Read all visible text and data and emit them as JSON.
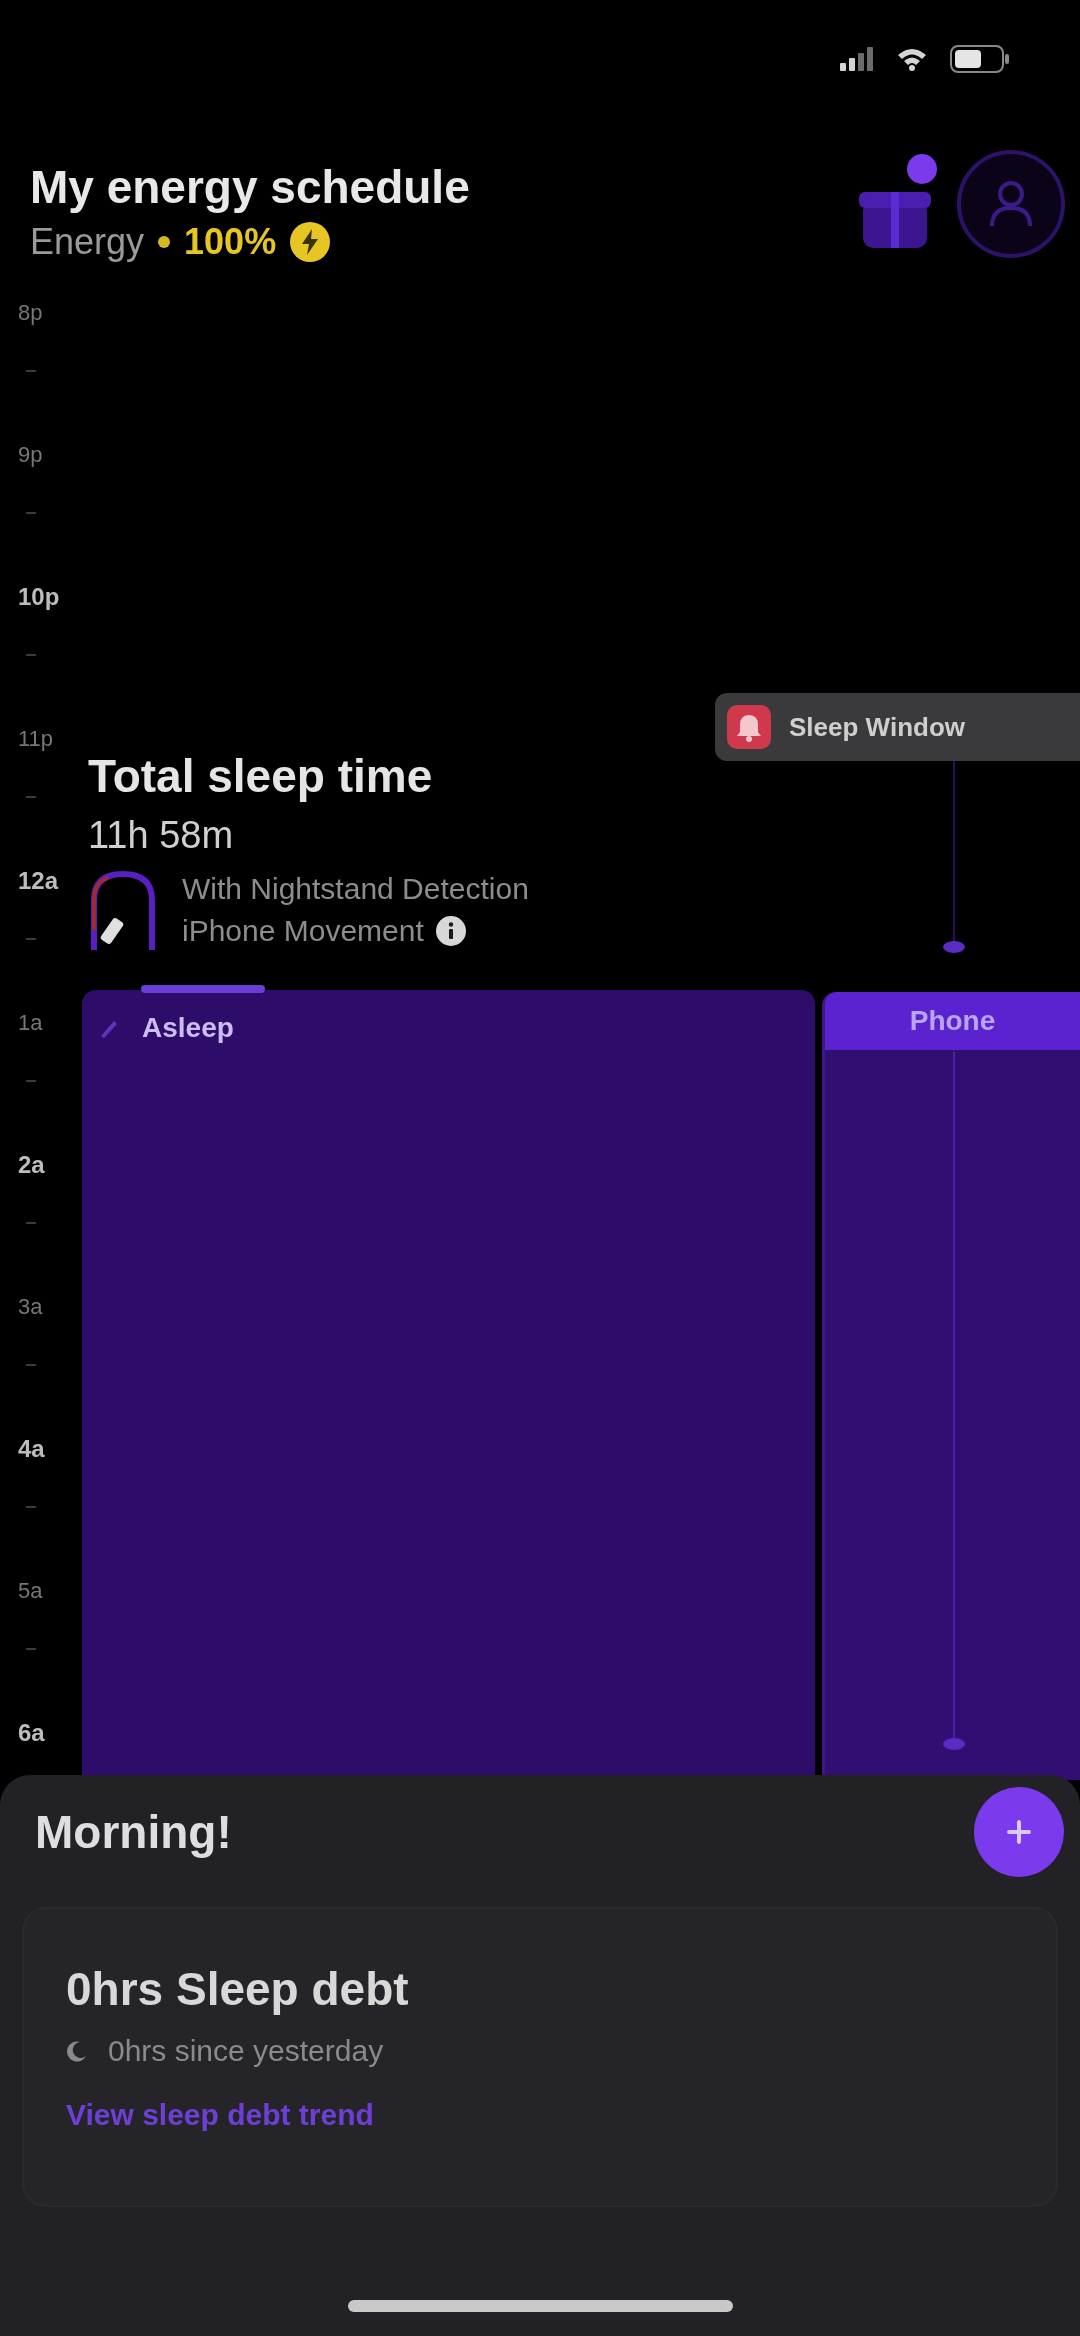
{
  "header": {
    "title": "My energy schedule",
    "subtitle": "Energy",
    "energy_value": "100%",
    "notification_badge": true
  },
  "timeline": {
    "hours": [
      {
        "label": "8p",
        "emphasized": false
      },
      {
        "label": "9p",
        "emphasized": false
      },
      {
        "label": "10p",
        "emphasized": true
      },
      {
        "label": "11p",
        "emphasized": false
      },
      {
        "label": "12a",
        "emphasized": true
      },
      {
        "label": "1a",
        "emphasized": false
      },
      {
        "label": "2a",
        "emphasized": true
      },
      {
        "label": "3a",
        "emphasized": false
      },
      {
        "label": "4a",
        "emphasized": true
      },
      {
        "label": "5a",
        "emphasized": false
      },
      {
        "label": "6a",
        "emphasized": true
      }
    ]
  },
  "sleep_window": {
    "label": "Sleep Window"
  },
  "sleep_summary": {
    "title": "Total sleep time",
    "duration": "11h 58m",
    "source_lines": [
      "With Nightstand Detection",
      "iPhone Movement"
    ]
  },
  "sleep_block": {
    "label": "Asleep"
  },
  "phone_column": {
    "label": "Phone"
  },
  "morning_sheet": {
    "title": "Morning!",
    "card": {
      "title": "0hrs Sleep debt",
      "detail": "0hrs since yesterday",
      "link": "View sleep debt trend"
    }
  }
}
